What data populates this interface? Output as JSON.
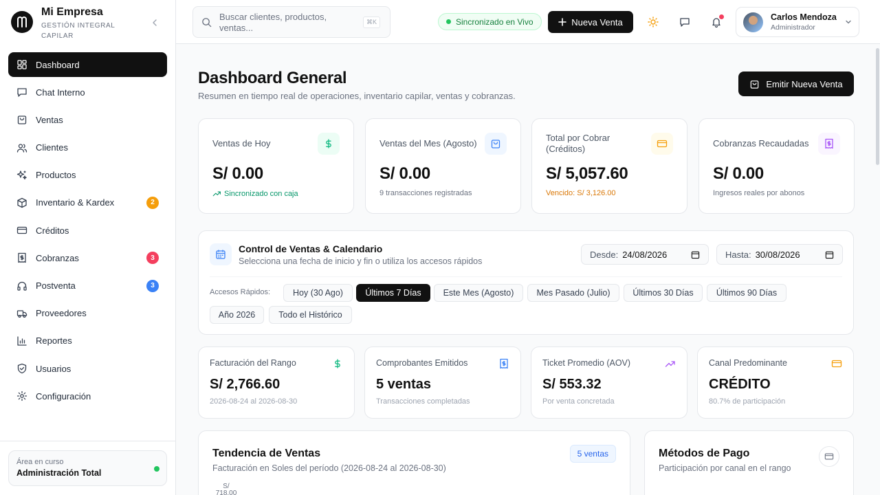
{
  "brand": {
    "name": "Mi Empresa",
    "subtitle": "GESTIÓN INTEGRAL CAPILAR"
  },
  "sidebar": {
    "items": [
      {
        "label": "Dashboard",
        "icon": "dashboard-icon",
        "active": true
      },
      {
        "label": "Chat Interno",
        "icon": "chat-icon"
      },
      {
        "label": "Ventas",
        "icon": "shopping-bag-icon"
      },
      {
        "label": "Clientes",
        "icon": "users-icon"
      },
      {
        "label": "Productos",
        "icon": "sparkles-icon"
      },
      {
        "label": "Inventario & Kardex",
        "icon": "box-icon",
        "badge": "2",
        "badge_color": "#f59e0b"
      },
      {
        "label": "Créditos",
        "icon": "credit-card-icon"
      },
      {
        "label": "Cobranzas",
        "icon": "receipt-dollar-icon",
        "badge": "3",
        "badge_color": "#f43f5e"
      },
      {
        "label": "Postventa",
        "icon": "headphones-icon",
        "badge": "3",
        "badge_color": "#3b82f6"
      },
      {
        "label": "Proveedores",
        "icon": "truck-icon"
      },
      {
        "label": "Reportes",
        "icon": "bar-chart-icon"
      },
      {
        "label": "Usuarios",
        "icon": "shield-icon"
      },
      {
        "label": "Configuración",
        "icon": "gear-icon"
      }
    ],
    "area": {
      "label": "Área en curso",
      "value": "Administración Total"
    }
  },
  "topbar": {
    "search_placeholder": "Buscar clientes, productos, ventas...",
    "search_shortcut": "⌘K",
    "live_status": "Sincronizado en Vivo",
    "new_sale": "Nueva Venta",
    "user": {
      "name": "Carlos Mendoza",
      "role": "Administrador"
    }
  },
  "page": {
    "title": "Dashboard General",
    "subtitle": "Resumen en tiempo real de operaciones, inventario capilar, ventas y cobranzas.",
    "emit_button": "Emitir Nueva Venta"
  },
  "kpis": [
    {
      "label": "Ventas de Hoy",
      "value": "S/ 0.00",
      "foot": "Sincronizado con caja",
      "icon": "dollar-icon",
      "icon_color": "#10b981",
      "icon_bg": "#ecfdf5",
      "foot_color": "#059669"
    },
    {
      "label": "Ventas del Mes (Agosto)",
      "value": "S/ 0.00",
      "foot": "9 transacciones registradas",
      "icon": "shopping-bag-icon",
      "icon_color": "#3b82f6",
      "icon_bg": "#eff6ff",
      "foot_color": "#6b7280"
    },
    {
      "label": "Total por Cobrar (Créditos)",
      "value": "S/ 5,057.60",
      "foot": "Vencido: S/ 3,126.00",
      "icon": "credit-card-icon",
      "icon_color": "#f59e0b",
      "icon_bg": "#fffbeb",
      "foot_color": "#d97706"
    },
    {
      "label": "Cobranzas Recaudadas",
      "value": "S/ 0.00",
      "foot": "Ingresos reales por abonos",
      "icon": "receipt-dollar-icon",
      "icon_color": "#a855f7",
      "icon_bg": "#faf5ff",
      "foot_color": "#6b7280"
    }
  ],
  "control": {
    "title": "Control de Ventas & Calendario",
    "subtitle": "Selecciona una fecha de inicio y fin o utiliza los accesos rápidos",
    "from_label": "Desde:",
    "from_value": "24/08/2026",
    "to_label": "Hasta:",
    "to_value": "30/08/2026",
    "quick_label": "Accesos Rápidos:",
    "chips": [
      {
        "label": "Hoy (30 Ago)"
      },
      {
        "label": "Últimos 7 Días",
        "active": true
      },
      {
        "label": "Este Mes (Agosto)"
      },
      {
        "label": "Mes Pasado (Julio)"
      },
      {
        "label": "Últimos 30 Días"
      },
      {
        "label": "Últimos 90 Días"
      },
      {
        "label": "Año 2026"
      },
      {
        "label": "Todo el Histórico"
      }
    ]
  },
  "range_kpis": [
    {
      "label": "Facturación del Rango",
      "value": "S/ 2,766.60",
      "foot": "2026-08-24 al 2026-08-30",
      "icon": "dollar-icon",
      "icon_color": "#10b981"
    },
    {
      "label": "Comprobantes Emitidos",
      "value": "5 ventas",
      "foot": "Transacciones completadas",
      "icon": "receipt-dollar-icon",
      "icon_color": "#3b82f6"
    },
    {
      "label": "Ticket Promedio (AOV)",
      "value": "S/ 553.32",
      "foot": "Por venta concretada",
      "icon": "trending-up-icon",
      "icon_color": "#a855f7"
    },
    {
      "label": "Canal Predominante",
      "value": "CRÉDITO",
      "foot": "80.7% de participación",
      "icon": "credit-card-icon",
      "icon_color": "#f59e0b"
    }
  ],
  "trend": {
    "title": "Tendencia de Ventas",
    "subtitle": "Facturación en Soles del período (2026-08-24 al 2026-08-30)",
    "badge": "5 ventas",
    "axis_top": "S/ 718.00"
  },
  "payments": {
    "title": "Métodos de Pago",
    "subtitle": "Participación por canal en el rango"
  }
}
